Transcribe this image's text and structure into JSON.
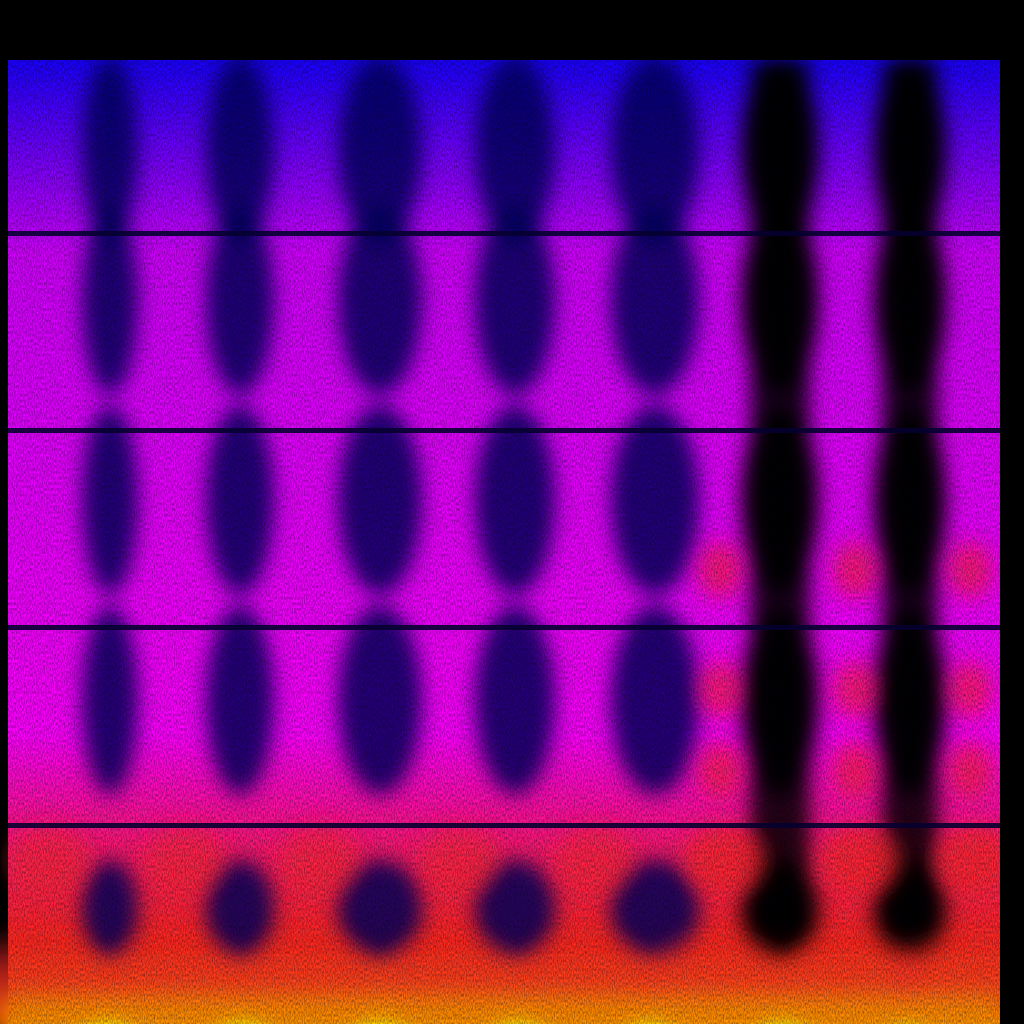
{
  "image": {
    "kind": "spectrogram",
    "colormap": [
      "#000000",
      "#1a00ff",
      "#ff00ff",
      "#ff2a2a",
      "#ff7a00",
      "#ffff00"
    ],
    "background": "#000000",
    "axis_labels_visible": false,
    "title_visible": false
  }
}
